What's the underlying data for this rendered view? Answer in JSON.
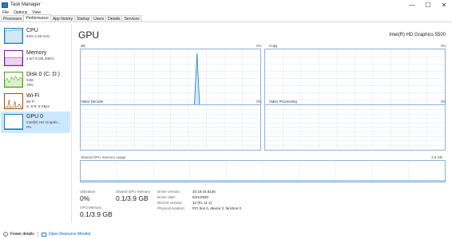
{
  "window": {
    "title": "Task Manager",
    "controls": {
      "minimize": "—",
      "maximize": "☐",
      "close": "✕"
    }
  },
  "menu": [
    "File",
    "Options",
    "View"
  ],
  "tabs": [
    "Processes",
    "Performance",
    "App history",
    "Startup",
    "Users",
    "Details",
    "Services"
  ],
  "active_tab": "Performance",
  "sidebar": {
    "items": [
      {
        "title": "CPU",
        "sub1": "94% 2.49 GHz",
        "sub2": "",
        "color": "#117dbb"
      },
      {
        "title": "Memory",
        "sub1": "4.6/7.9 GB (58%)",
        "sub2": "",
        "color": "#8b12ae"
      },
      {
        "title": "Disk 0 (C: D:)",
        "sub1": "SSD",
        "sub2": "78%",
        "color": "#4da60c"
      },
      {
        "title": "Wi-Fi",
        "sub1": "Wi-Fi",
        "sub2": "S: 8 R: 8 Kbps",
        "color": "#a74f01"
      },
      {
        "title": "GPU 0",
        "sub1": "Intel(R) HD Graphic...",
        "sub2": "0%",
        "color": "#117dbb"
      }
    ],
    "selected_index": 4
  },
  "main": {
    "title": "GPU",
    "model": "Intel(R) HD Graphics 5500",
    "graphs": [
      {
        "label": "3D",
        "percent": "0%"
      },
      {
        "label": "Copy",
        "percent": "0%"
      },
      {
        "label": "Video Decode",
        "percent": "0%"
      },
      {
        "label": "Video Processing",
        "percent": "0%"
      }
    ],
    "shared_memory": {
      "label": "Shared GPU memory usage",
      "max": "3.9 GB"
    },
    "stats": {
      "utilization_label": "Utilization",
      "utilization_value": "0%",
      "shared_label": "Shared GPU memory",
      "shared_value": "0.1/3.9 GB",
      "gpu_memory_label": "GPU Memory",
      "gpu_memory_value": "0.1/3.9 GB"
    },
    "info": [
      {
        "label": "Driver version:",
        "value": "20.19.15.5126"
      },
      {
        "label": "Driver date:",
        "value": "5/21/2020"
      },
      {
        "label": "DirectX version:",
        "value": "12 (FL 11.1)"
      },
      {
        "label": "Physical location:",
        "value": "PCI bus 0, device 2, function 0"
      }
    ]
  },
  "footer": {
    "fewer_details": "Fewer details",
    "open_monitor": "Open Resource Monitor"
  },
  "colors": {
    "graph_border": "#8ab2de",
    "graph_line": "#117dbb",
    "grid": "#d9e6f2",
    "selected": "#cce8ff"
  }
}
